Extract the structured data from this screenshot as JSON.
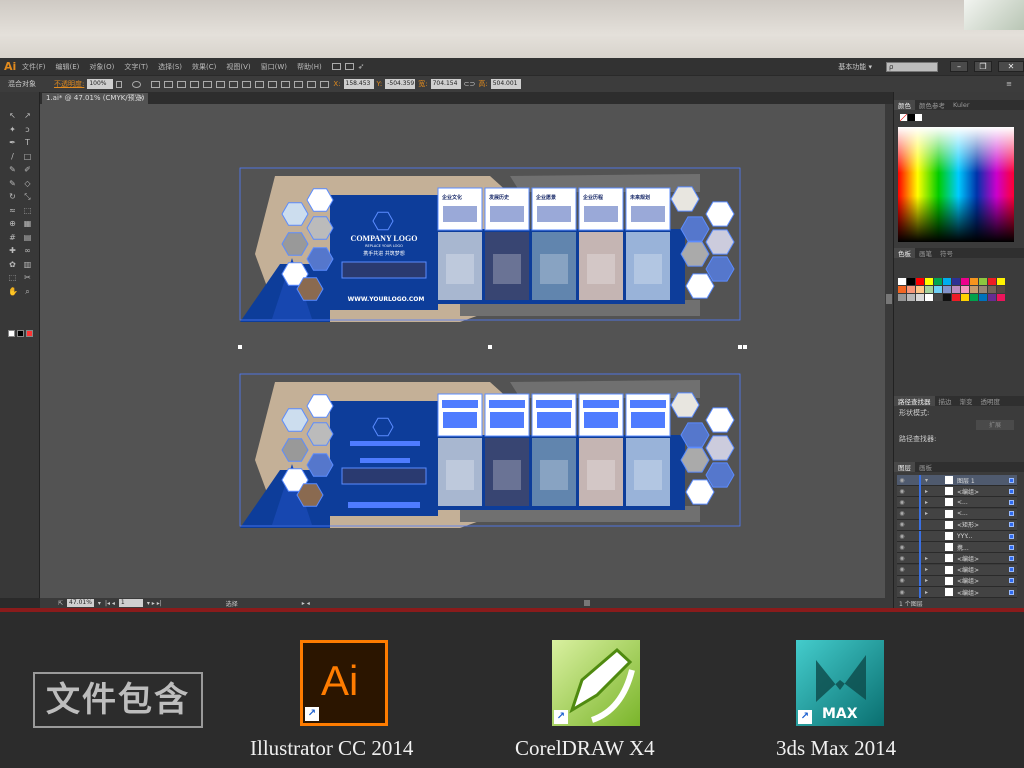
{
  "app": {
    "logo": "Ai"
  },
  "menu": [
    "文件(F)",
    "编辑(E)",
    "对象(O)",
    "文字(T)",
    "选择(S)",
    "效果(C)",
    "视图(V)",
    "窗口(W)",
    "帮助(H)"
  ],
  "workspace": {
    "label": "基本功能 ▾",
    "search_placeholder": "ρ"
  },
  "window_buttons": [
    "–",
    "❐",
    "✕"
  ],
  "control_bar": {
    "selection_label": "混合对象",
    "opacity_label": "不透明度:",
    "opacity_value": "100%",
    "x_label": "X:",
    "x_value": "158.453",
    "y_label": "Y:",
    "y_value": "-504.359",
    "w_label": "宽:",
    "w_value": "704.154",
    "h_label": "高:",
    "h_value": "504.001"
  },
  "document_tab": {
    "title": "1.ai* @ 47.01% (CMYK/预览)",
    "close": "×"
  },
  "artwork": {
    "company_logo": "COMPANY LOGO",
    "replace_logo": "REPLACE YOUR LOGO",
    "slogan": "携手共进  共筑梦想",
    "website": "WWW.YOURLOGO.COM",
    "cards": [
      "企业文化",
      "发展历史",
      "企业愿景",
      "企业历程",
      "未来规划"
    ]
  },
  "status_bar": {
    "zoom": "47.01%",
    "page": "1",
    "tool": "选择"
  },
  "panels": {
    "color_tabs": [
      "颜色",
      "颜色参考",
      "Kuler"
    ],
    "swatch_tabs": [
      "色板",
      "画笔",
      "符号"
    ],
    "swatches": [
      "#ffffff",
      "#000000",
      "#ff0000",
      "#ffff00",
      "#00a651",
      "#00aeef",
      "#2e3192",
      "#ec008c",
      "#f7941d",
      "#8dc63f",
      "#ed1c24",
      "#fff200",
      "#f26522",
      "#f7977a",
      "#fdc689",
      "#a3d39c",
      "#6dcff6",
      "#8393ca",
      "#bd8cbf",
      "#f49ac1",
      "#c69c6d",
      "#998675",
      "#736357",
      "#534741",
      "#959595",
      "#b7b7b7",
      "#d9d9d9",
      "#ffffff",
      "#464646",
      "#111111",
      "#ee1c25",
      "#ffd200",
      "#00a14b",
      "#0072bc",
      "#662d91",
      "#ed145b"
    ],
    "pathfinder_tabs": [
      "路径查找器",
      "描边",
      "渐变",
      "透明度"
    ],
    "shape_modes_label": "形状模式:",
    "expand_button": "扩展",
    "pathfinders_label": "路径查找器:",
    "layers_tabs": [
      "图层",
      "画板"
    ],
    "layers": [
      "图层 1",
      "<编组>",
      "<...",
      "<...",
      "<矩形>",
      "YYY...",
      "携...",
      "<编组>",
      "<编组>",
      "<编组>",
      "<编组>"
    ],
    "layers_count": "1 个图层"
  },
  "bottom": {
    "includes_label": "文件包含",
    "apps": [
      {
        "name": "Illustrator CC 2014",
        "icon_text": "Ai",
        "color": "#ff7c00"
      },
      {
        "name": "CorelDRAW X4",
        "icon_text": "",
        "color": "#8cc63f"
      },
      {
        "name": "3ds Max 2014",
        "icon_text": "MAX",
        "color": "#1b9a9a"
      }
    ]
  }
}
